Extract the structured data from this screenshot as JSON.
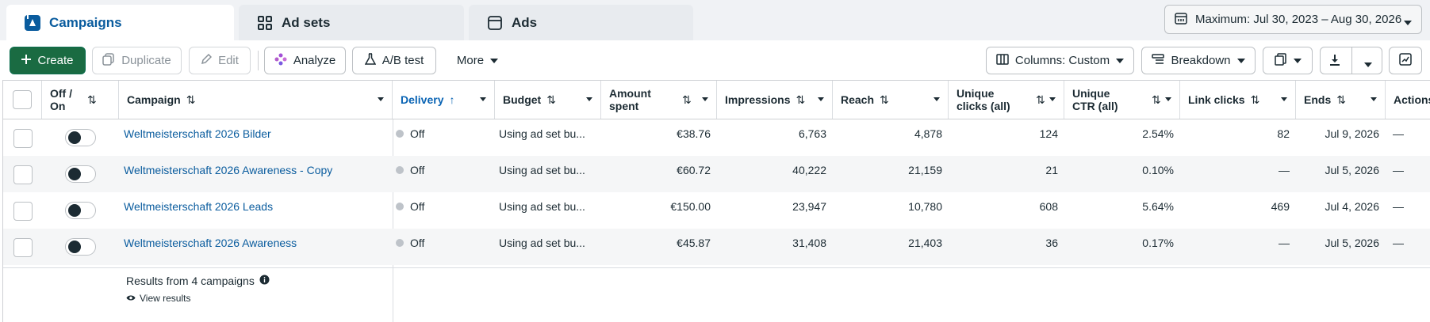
{
  "tabs": [
    {
      "label": "Campaigns",
      "icon": "campaigns-icon",
      "active": true
    },
    {
      "label": "Ad sets",
      "icon": "adsets-grid-icon",
      "active": false
    },
    {
      "label": "Ads",
      "icon": "ads-window-icon",
      "active": false
    }
  ],
  "date_range": {
    "label": "Maximum: Jul 30, 2023 – Aug 30, 2026"
  },
  "toolbar": {
    "create": "Create",
    "duplicate": "Duplicate",
    "edit": "Edit",
    "analyze": "Analyze",
    "ab_test": "A/B test",
    "more": "More",
    "columns": "Columns: Custom",
    "breakdown": "Breakdown"
  },
  "columns": {
    "off_on": "Off / On",
    "campaign": "Campaign",
    "delivery": "Delivery",
    "budget": "Budget",
    "amount_spent": "Amount spent",
    "impressions": "Impressions",
    "reach": "Reach",
    "unique_clicks": "Unique clicks (all)",
    "unique_ctr": "Unique CTR (all)",
    "link_clicks": "Link clicks",
    "ends": "Ends",
    "actions": "Actions"
  },
  "rows": [
    {
      "campaign": "Weltmeisterschaft 2026 Bilder",
      "delivery": "Off",
      "budget": "Using ad set bu...",
      "amount_spent": "€38.76",
      "impressions": "6,763",
      "reach": "4,878",
      "unique_clicks": "124",
      "unique_ctr": "2.54%",
      "link_clicks": "82",
      "ends": "Jul 9, 2026",
      "actions": "—"
    },
    {
      "campaign": "Weltmeisterschaft 2026 Awareness - Copy",
      "delivery": "Off",
      "budget": "Using ad set bu...",
      "amount_spent": "€60.72",
      "impressions": "40,222",
      "reach": "21,159",
      "unique_clicks": "21",
      "unique_ctr": "0.10%",
      "link_clicks": "—",
      "ends": "Jul 5, 2026",
      "actions": "—"
    },
    {
      "campaign": "Weltmeisterschaft 2026 Leads",
      "delivery": "Off",
      "budget": "Using ad set bu...",
      "amount_spent": "€150.00",
      "impressions": "23,947",
      "reach": "10,780",
      "unique_clicks": "608",
      "unique_ctr": "5.64%",
      "link_clicks": "469",
      "ends": "Jul 4, 2026",
      "actions": "—"
    },
    {
      "campaign": "Weltmeisterschaft 2026 Awareness",
      "delivery": "Off",
      "budget": "Using ad set bu...",
      "amount_spent": "€45.87",
      "impressions": "31,408",
      "reach": "21,403",
      "unique_clicks": "36",
      "unique_ctr": "0.17%",
      "link_clicks": "—",
      "ends": "Jul 5, 2026",
      "actions": "—"
    }
  ],
  "footer": {
    "results": "Results from 4 campaigns",
    "view_results": "View results"
  },
  "colors": {
    "accent": "#0a5c9e",
    "primary_button": "#1a6b42",
    "status_off_dot": "#bec3c9"
  }
}
